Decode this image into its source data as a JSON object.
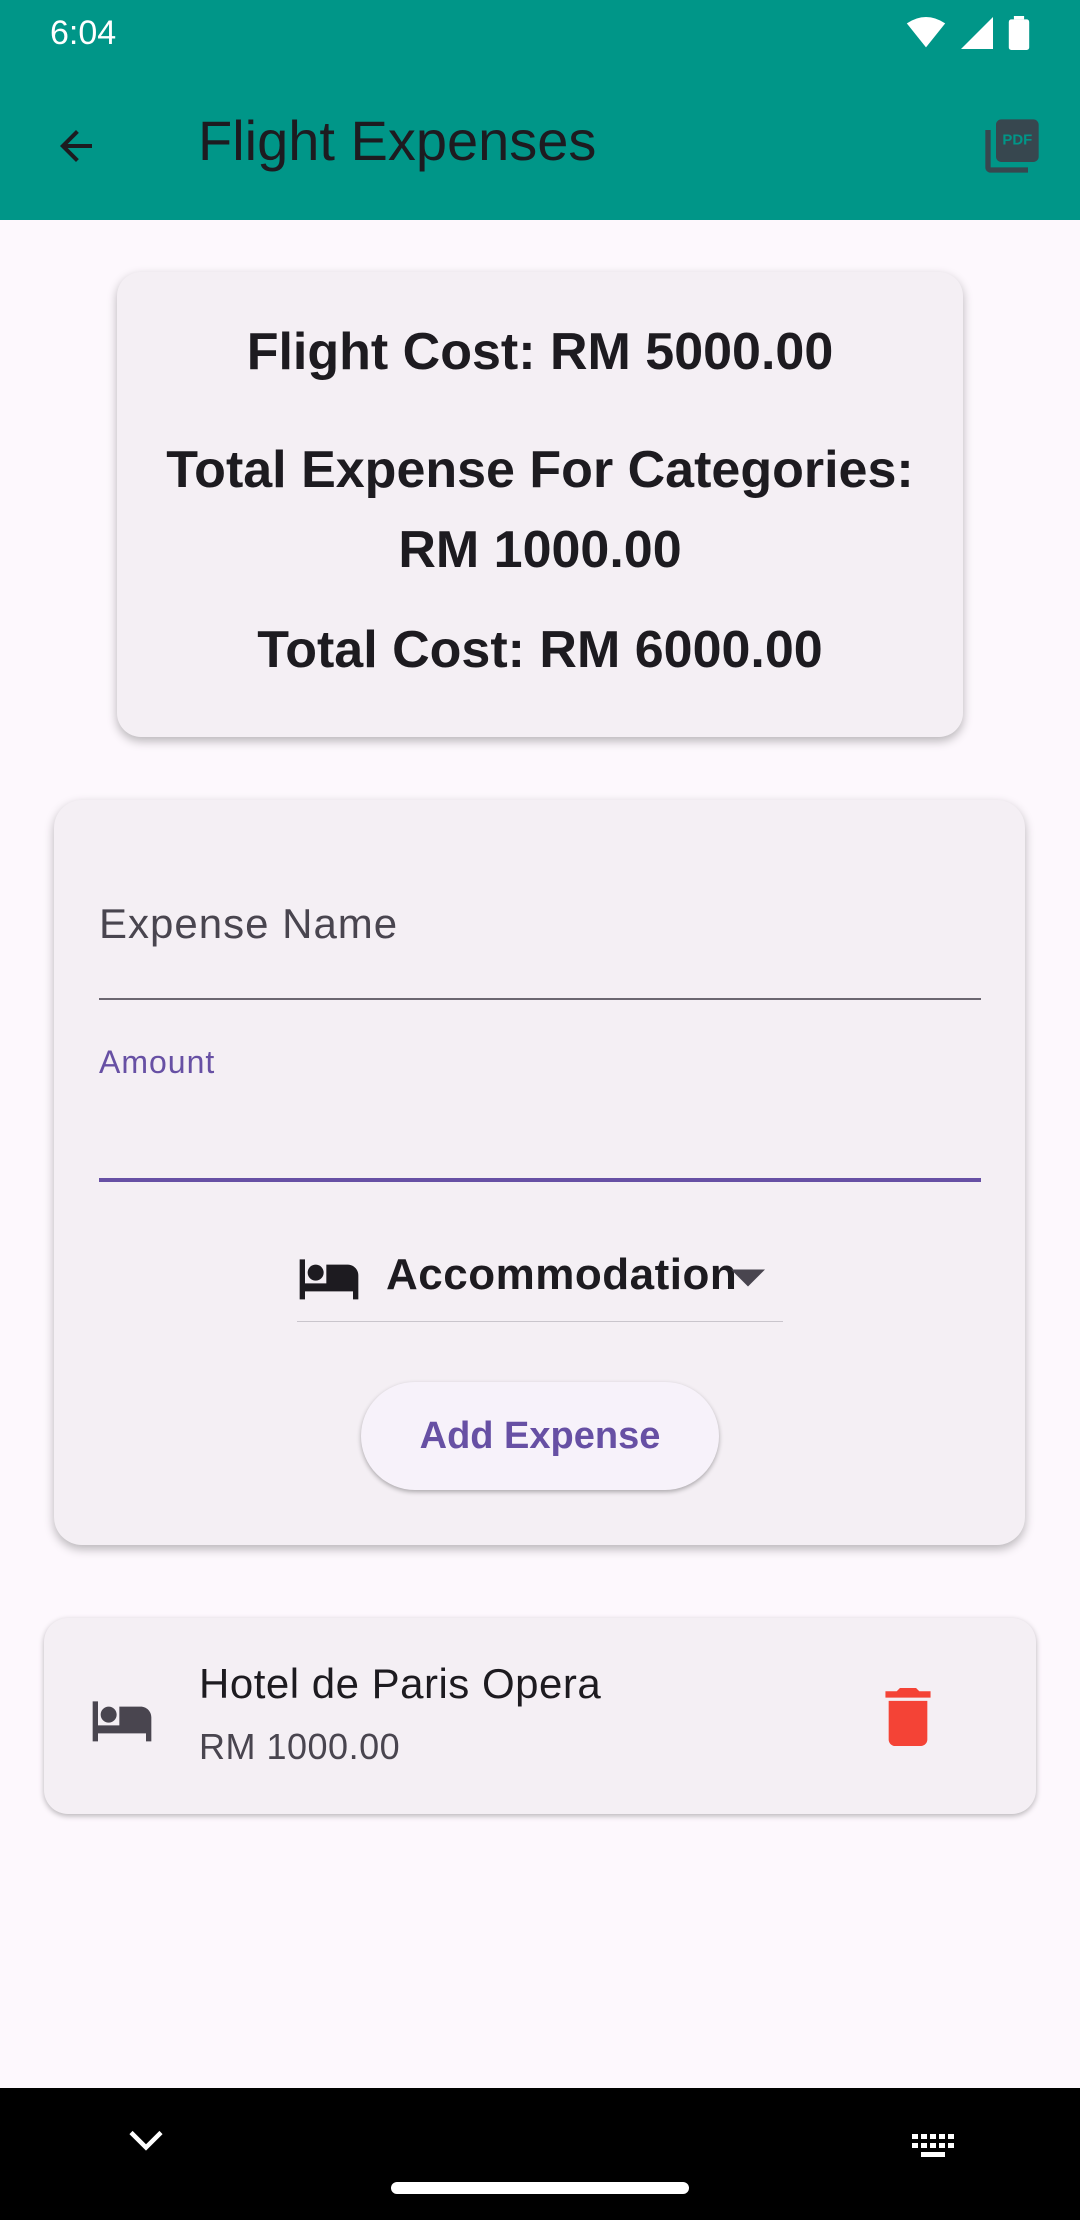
{
  "status": {
    "time": "6:04"
  },
  "appbar": {
    "title": "Flight Expenses"
  },
  "summary": {
    "flight_cost": "Flight Cost: RM 5000.00",
    "categories_total": "Total Expense For Categories: RM 1000.00",
    "total_cost": "Total Cost: RM 6000.00"
  },
  "form": {
    "name_placeholder": "Expense Name",
    "amount_label": "Amount",
    "amount_value": "",
    "category": "Accommodation",
    "add_button": "Add Expense"
  },
  "expenses": [
    {
      "name": "Hotel de Paris Opera",
      "amount": "RM 1000.00",
      "icon": "bed-icon"
    }
  ],
  "colors": {
    "appbar": "#009688",
    "accent": "#6750a4",
    "delete": "#f44336"
  }
}
